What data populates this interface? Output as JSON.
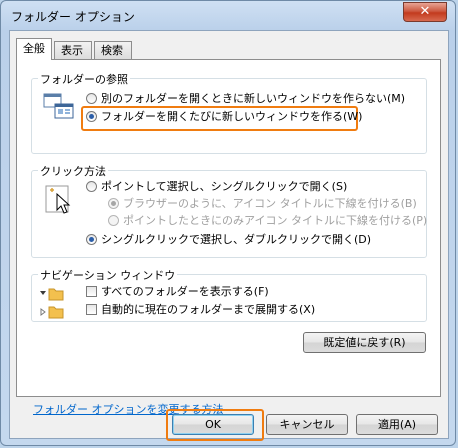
{
  "window": {
    "title": "フォルダー オプション",
    "close_label": "✕"
  },
  "tabs": [
    {
      "label": "全般",
      "active": true
    },
    {
      "label": "表示",
      "active": false
    },
    {
      "label": "検索",
      "active": false
    }
  ],
  "browse_folders": {
    "label": "フォルダーの参照",
    "options": [
      {
        "label": "別のフォルダーを開くときに新しいウィンドウを作らない(M)",
        "checked": false
      },
      {
        "label": "フォルダーを開くたびに新しいウィンドウを作る(W)",
        "checked": true
      }
    ]
  },
  "click_items": {
    "label": "クリック方法",
    "single_click": "ポイントして選択し、シングルクリックで開く(S)",
    "sub_options": [
      {
        "label": "ブラウザーのように、アイコン タイトルに下線を付ける(B)",
        "checked": true
      },
      {
        "label": "ポイントしたときにのみアイコン タイトルに下線を付ける(P)",
        "checked": false
      }
    ],
    "double_click": "シングルクリックで選択し、ダブルクリックで開く(D)"
  },
  "navigation_pane": {
    "label": "ナビゲーション ウィンドウ",
    "options": [
      {
        "label": "すべてのフォルダーを表示する(F)",
        "checked": false
      },
      {
        "label": "自動的に現在のフォルダーまで展開する(X)",
        "checked": false
      }
    ]
  },
  "restore_defaults_label": "既定値に戻す(R)",
  "help_link": "フォルダー オプションを変更する方法",
  "footer": {
    "ok_label": "OK",
    "cancel_label": "キャンセル",
    "apply_label": "適用(A)"
  },
  "accent_color": "#f07c10"
}
